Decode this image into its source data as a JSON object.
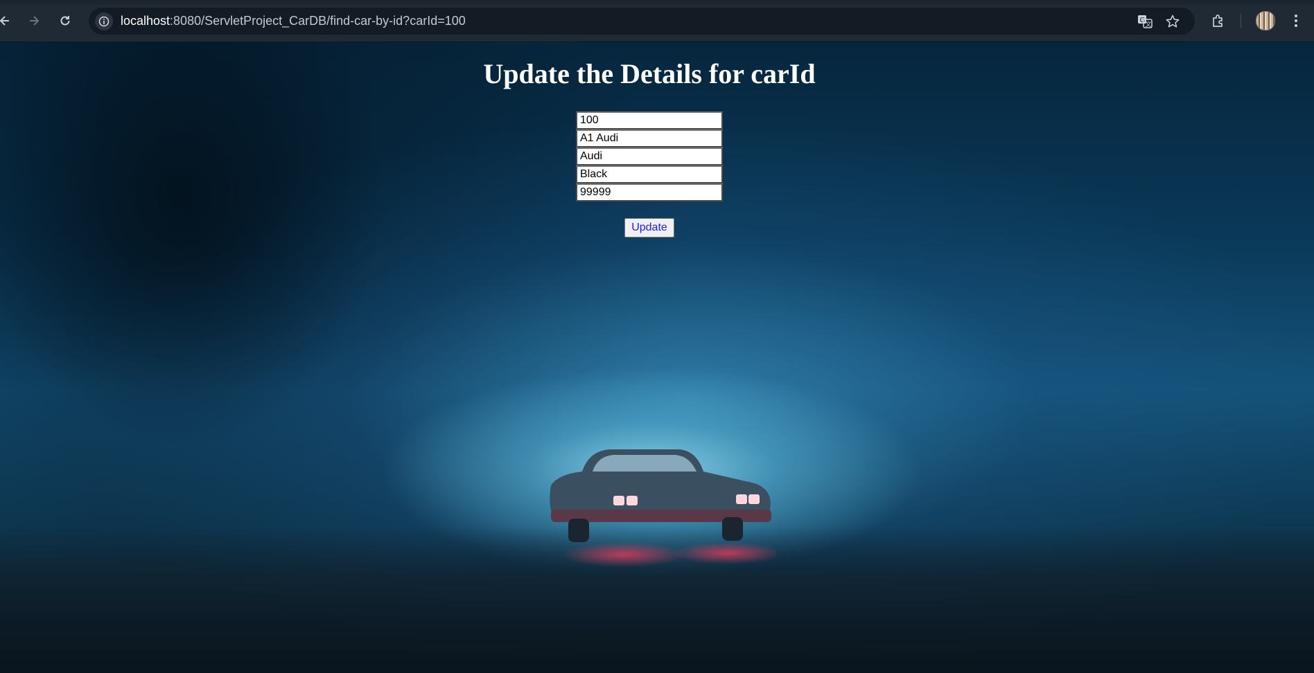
{
  "browser": {
    "url_host": "localhost",
    "url_rest": ":8080/ServletProject_CarDB/find-car-by-id?carId=100",
    "icons": {
      "back": "back-arrow-icon",
      "forward": "forward-arrow-icon",
      "reload": "reload-icon",
      "site_info": "info-icon",
      "translate": "translate-icon",
      "bookmark": "star-icon",
      "extensions": "puzzle-icon",
      "profile": "avatar",
      "menu": "kebab-menu-icon"
    }
  },
  "page": {
    "title": "Update the Details for carId",
    "fields": {
      "car_id": "100",
      "model": "A1 Audi",
      "brand": "Audi",
      "color": "Black",
      "price": "99999"
    },
    "update_label": "Update"
  },
  "colors": {
    "chrome_bg": "#202a34",
    "omnibox_bg": "#131b24",
    "title_text": "#ffffff",
    "button_text": "#1a1aff"
  }
}
